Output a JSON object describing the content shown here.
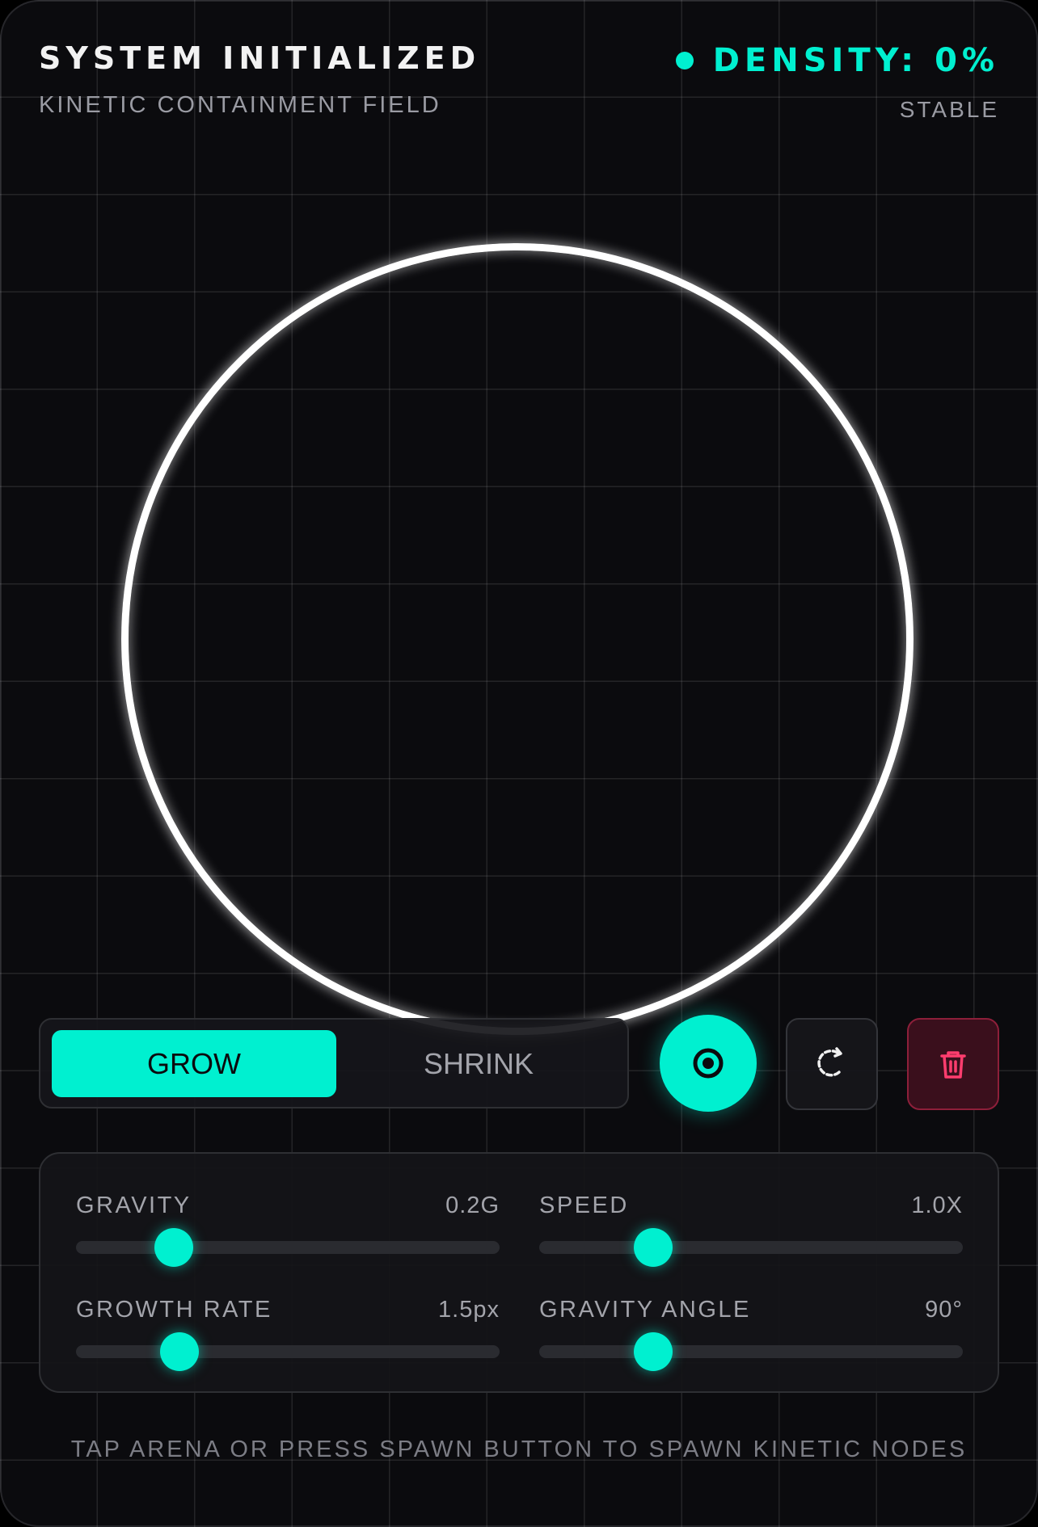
{
  "header": {
    "title": "SYSTEM INITIALIZED",
    "subtitle": "KINETIC CONTAINMENT FIELD",
    "density_label": "DENSITY: 0%",
    "status": "STABLE"
  },
  "mode_toggle": {
    "grow_label": "GROW",
    "shrink_label": "SHRINK",
    "selected": "GROW"
  },
  "actions": {
    "spawn_icon": "target-icon",
    "reset_icon": "reset-icon",
    "clear_icon": "trash-icon"
  },
  "sliders": [
    {
      "label": "GRAVITY",
      "value": "0.2G",
      "fraction": 0.23
    },
    {
      "label": "SPEED",
      "value": "1.0X",
      "fraction": 0.27
    },
    {
      "label": "GROWTH RATE",
      "value": "1.5px",
      "fraction": 0.245
    },
    {
      "label": "GRAVITY ANGLE",
      "value": "90°",
      "fraction": 0.27
    }
  ],
  "footer": {
    "hint": "TAP ARENA OR PRESS SPAWN BUTTON TO SPAWN KINETIC NODES"
  },
  "colors": {
    "accent": "#00f0d0",
    "background": "#0b0b0e",
    "danger": "#ff3d6e"
  }
}
